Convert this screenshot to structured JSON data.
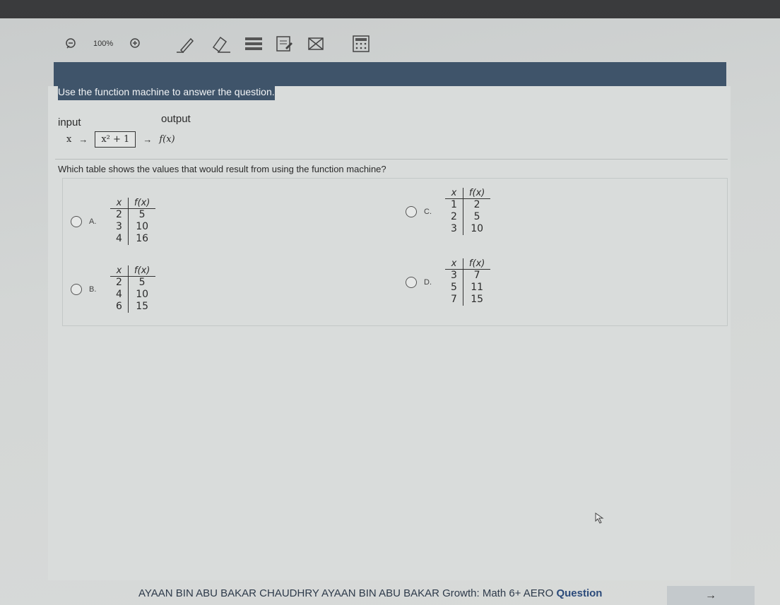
{
  "toolbar": {
    "zoom": "100%",
    "icons": [
      "zoom-out-icon",
      "zoom-in-icon",
      "pencil-icon",
      "eraser-icon",
      "line-reader-icon",
      "notes-icon",
      "eliminate-icon",
      "calculator-icon"
    ]
  },
  "question": {
    "prompt": "Use the function machine to answer the question.",
    "input_label": "input",
    "output_label": "output",
    "machine_input": "x",
    "machine_rule": "x² + 1",
    "machine_output": "f(x)",
    "text": "Which table shows the values that would result from using the function machine?"
  },
  "options": [
    {
      "letter": "A.",
      "header": [
        "x",
        "f(x)"
      ],
      "rows": [
        [
          "2",
          "5"
        ],
        [
          "3",
          "10"
        ],
        [
          "4",
          "16"
        ]
      ]
    },
    {
      "letter": "B.",
      "header": [
        "x",
        "f(x)"
      ],
      "rows": [
        [
          "2",
          "5"
        ],
        [
          "4",
          "10"
        ],
        [
          "6",
          "15"
        ]
      ]
    },
    {
      "letter": "C.",
      "header": [
        "x",
        "f(x)"
      ],
      "rows": [
        [
          "1",
          "2"
        ],
        [
          "2",
          "5"
        ],
        [
          "3",
          "10"
        ]
      ]
    },
    {
      "letter": "D.",
      "header": [
        "x",
        "f(x)"
      ],
      "rows": [
        [
          "3",
          "7"
        ],
        [
          "5",
          "11"
        ],
        [
          "7",
          "15"
        ]
      ]
    }
  ],
  "footer": {
    "student": "AYAAN BIN ABU BAKAR CHAUDHRY AYAAN BIN ABU BAKAR Growth: Math 6+ AERO",
    "question_label": "Question",
    "next_arrow": "→"
  }
}
